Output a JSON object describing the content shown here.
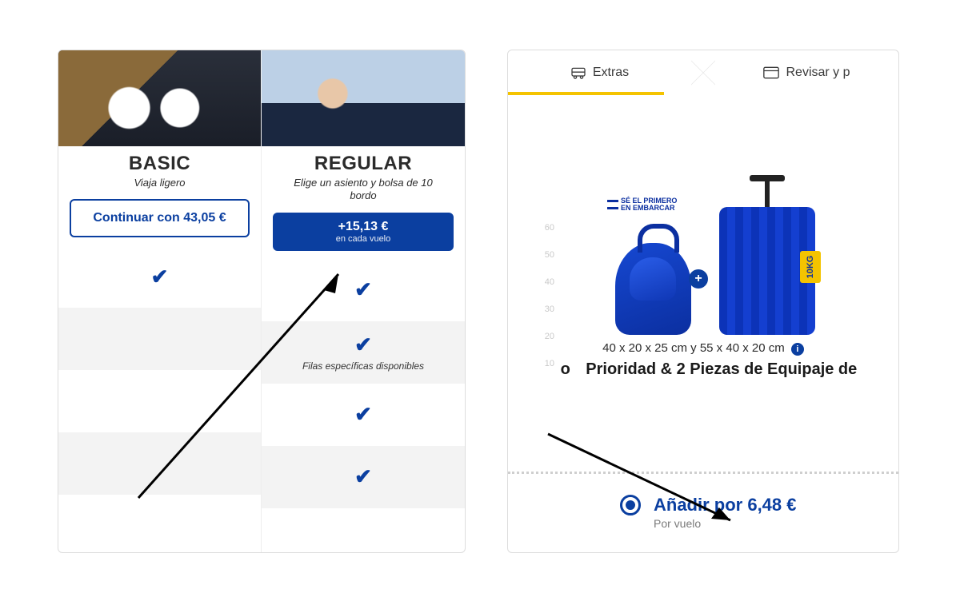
{
  "left": {
    "basic": {
      "title": "BASIC",
      "subtitle": "Viaja ligero",
      "button": "Continuar con 43,05 €"
    },
    "regular": {
      "title": "REGULAR",
      "subtitle": "Elige un asiento y bolsa de 10\nbordo",
      "price": "+15,13 €",
      "priceSub": "en cada vuelo",
      "rowNote": "Filas específicas disponibles"
    }
  },
  "right": {
    "crumbs": {
      "extras": "Extras",
      "review": "Revisar y p"
    },
    "axis": [
      "60",
      "50",
      "40",
      "30",
      "20",
      "10"
    ],
    "firstBoard1": "SÉ EL PRIMERO",
    "firstBoard2": "EN EMBARCAR",
    "weightTag": "10KG",
    "dims": "40 x 20 x 25 cm y 55 x 40 x 20 cm",
    "prioO": "o",
    "prioTitle": "Prioridad & 2 Piezas de Equipaje de",
    "addLabel": "Añadir por 6,48 €",
    "addSub": "Por vuelo"
  }
}
